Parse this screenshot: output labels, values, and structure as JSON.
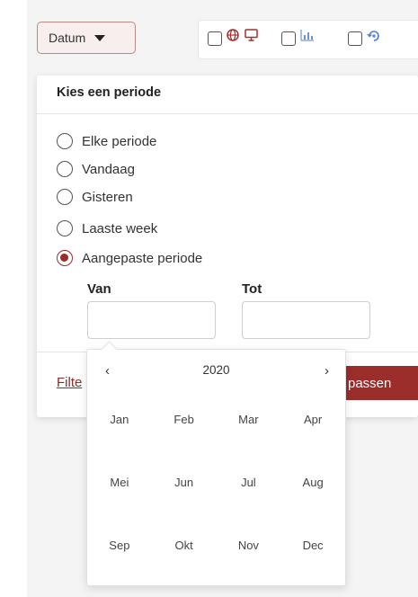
{
  "filter_bar": {
    "date_button_label": "Datum",
    "type_filters": [
      {
        "icons": [
          "globe-icon",
          "monitor-icon"
        ]
      },
      {
        "icons": [
          "chart-icon"
        ]
      },
      {
        "icons": [
          "history-icon"
        ]
      }
    ]
  },
  "period_panel": {
    "title": "Kies een periode",
    "options": [
      {
        "label": "Elke periode",
        "checked": false
      },
      {
        "label": "Vandaag",
        "checked": false
      },
      {
        "label": "Gisteren",
        "checked": false
      },
      {
        "label": "Laaste week",
        "checked": false
      },
      {
        "label": "Aangepaste periode",
        "checked": true
      }
    ],
    "from_label": "Van",
    "to_label": "Tot",
    "from_value": "",
    "to_value": "",
    "filter_link_label": "Filte",
    "apply_button_label": "passen"
  },
  "calendar": {
    "prev_symbol": "‹",
    "next_symbol": "›",
    "year": "2020",
    "months": [
      "Jan",
      "Feb",
      "Mar",
      "Apr",
      "Mei",
      "Jun",
      "Jul",
      "Aug",
      "Sep",
      "Okt",
      "Nov",
      "Dec"
    ]
  },
  "colors": {
    "accent": "#9b2d2b",
    "date_button_bg": "#f8eeee",
    "date_button_border": "#b98a89"
  }
}
